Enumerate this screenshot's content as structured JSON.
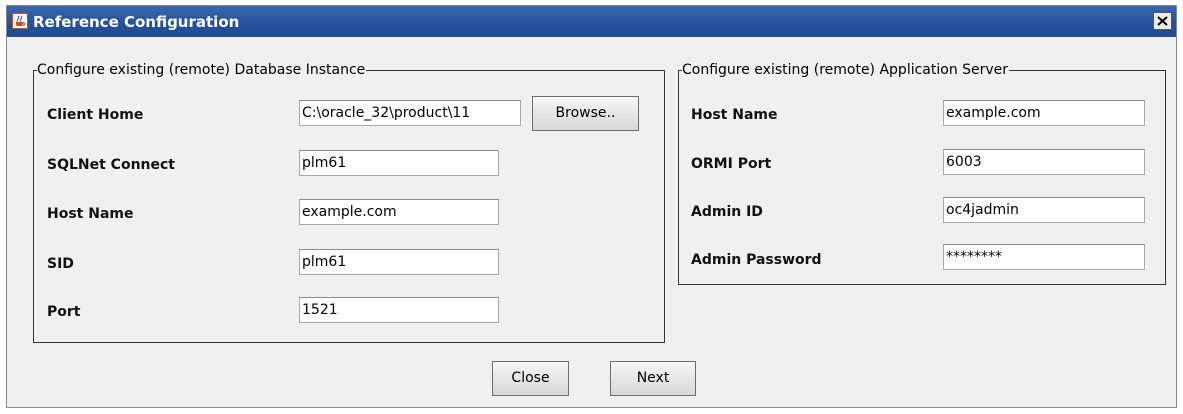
{
  "window": {
    "title": "Reference Configuration",
    "close_glyph": "✕",
    "icon": "java-cup-icon"
  },
  "db_group": {
    "legend": "Configure existing (remote) Database Instance",
    "client_home": {
      "label": "Client Home",
      "value": "C:\\oracle_32\\product\\11"
    },
    "browse_label": "Browse..",
    "sqlnet": {
      "label": "SQLNet Connect",
      "value": "plm61"
    },
    "host": {
      "label": "Host Name",
      "value": "example.com"
    },
    "sid": {
      "label": "SID",
      "value": "plm61"
    },
    "port": {
      "label": "Port",
      "value": "1521"
    }
  },
  "app_group": {
    "legend": "Configure existing (remote) Application Server",
    "host": {
      "label": "Host Name",
      "value": "example.com"
    },
    "ormi_port": {
      "label": "ORMI Port",
      "value": "6003"
    },
    "admin_id": {
      "label": "Admin ID",
      "value": "oc4jadmin"
    },
    "admin_password": {
      "label": "Admin Password",
      "value": "********"
    }
  },
  "buttons": {
    "close_label": "Close",
    "next_label": "Next"
  }
}
